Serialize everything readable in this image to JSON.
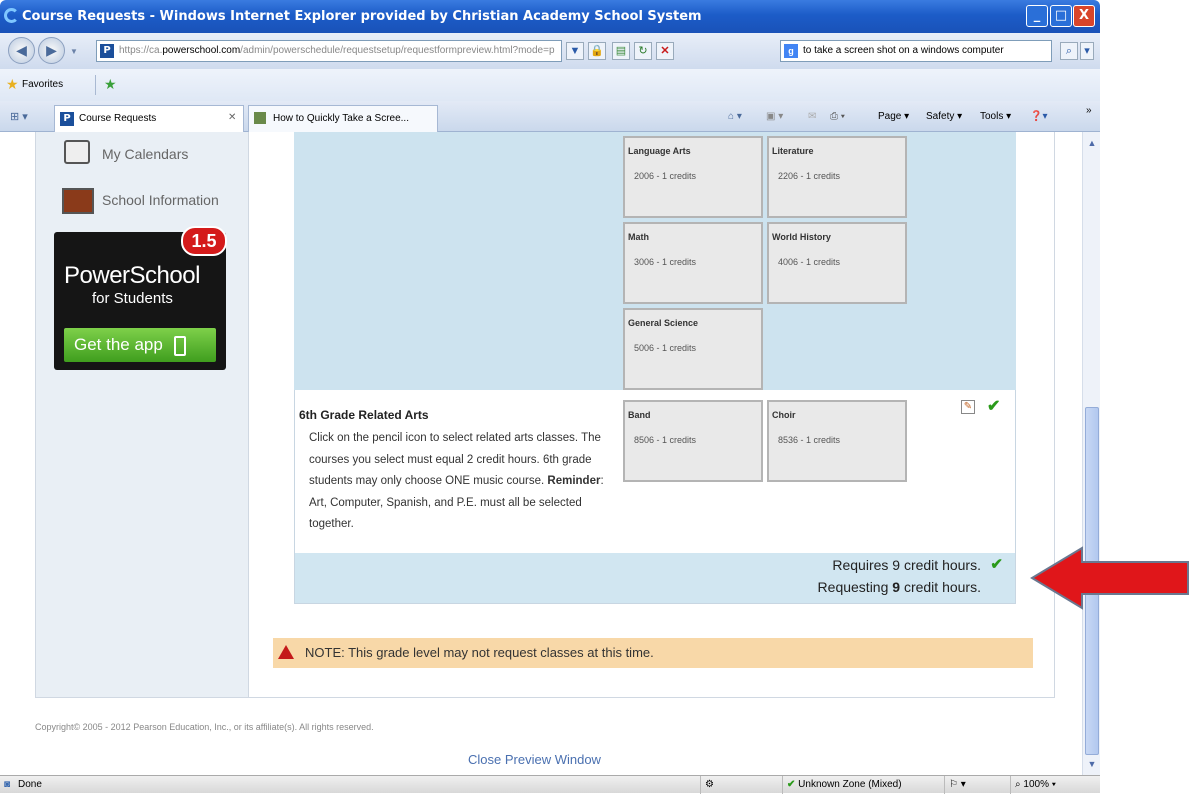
{
  "window": {
    "title": "Course Requests - Windows Internet Explorer provided by Christian Academy School System",
    "minimize": "_",
    "maximize": "□",
    "close": "X"
  },
  "address": {
    "prefix": "https://ca.",
    "domain": "powerschool.com",
    "path": "/admin/powerschedule/requestsetup/requestformpreview.html?mode=p",
    "search_text": "to take a screen shot on a windows computer"
  },
  "favorites": {
    "label": "Favorites"
  },
  "tabs": [
    {
      "label": "Course Requests"
    },
    {
      "label": "How to Quickly Take a Scree..."
    }
  ],
  "toolbar": {
    "page": "Page",
    "safety": "Safety",
    "tools": "Tools",
    "more": "»"
  },
  "sidebar": {
    "links": [
      {
        "label": "My Calendars"
      },
      {
        "label": "School Information"
      }
    ],
    "ad": {
      "badge": "1.5",
      "title": "PowerSchool",
      "subtitle": "for Students",
      "button": "Get the app"
    }
  },
  "courses": [
    {
      "name": "Language Arts",
      "credits": "2006 - 1 credits"
    },
    {
      "name": "Literature",
      "credits": "2206 - 1 credits"
    },
    {
      "name": "Math",
      "credits": "3006 - 1 credits"
    },
    {
      "name": "World History",
      "credits": "4006 - 1 credits"
    },
    {
      "name": "General Science",
      "credits": "5006 - 1 credits"
    }
  ],
  "related_arts": {
    "heading": "6th Grade Related Arts",
    "text_1": "Click on the pencil icon to select related arts classes. The courses you select must equal 2 credit hours. 6th grade students may only choose ONE music course. ",
    "reminder_label": "Reminder",
    "text_2": ": Art, Computer, Spanish, and P.E. must all be selected together.",
    "courses": [
      {
        "name": "Band",
        "credits": "8506 - 1 credits"
      },
      {
        "name": "Choir",
        "credits": "8536 - 1 credits"
      }
    ]
  },
  "summary": {
    "requires": "Requires 9 credit hours.",
    "requesting_prefix": "Requesting ",
    "requesting_value": "9",
    "requesting_suffix": " credit hours."
  },
  "note": "NOTE: This grade level may not request classes at this time.",
  "footer": {
    "copyright": "Copyright© 2005 - 2012 Pearson Education, Inc., or its affiliate(s). All rights reserved.",
    "close_preview": "Close Preview Window"
  },
  "statusbar": {
    "status": "Done",
    "zone": "Unknown Zone (Mixed)",
    "zoom": "100%"
  },
  "colors": {
    "accent_red": "#e0161a",
    "check_green": "#2a9a1a",
    "note_bg": "#f8d8a8"
  }
}
